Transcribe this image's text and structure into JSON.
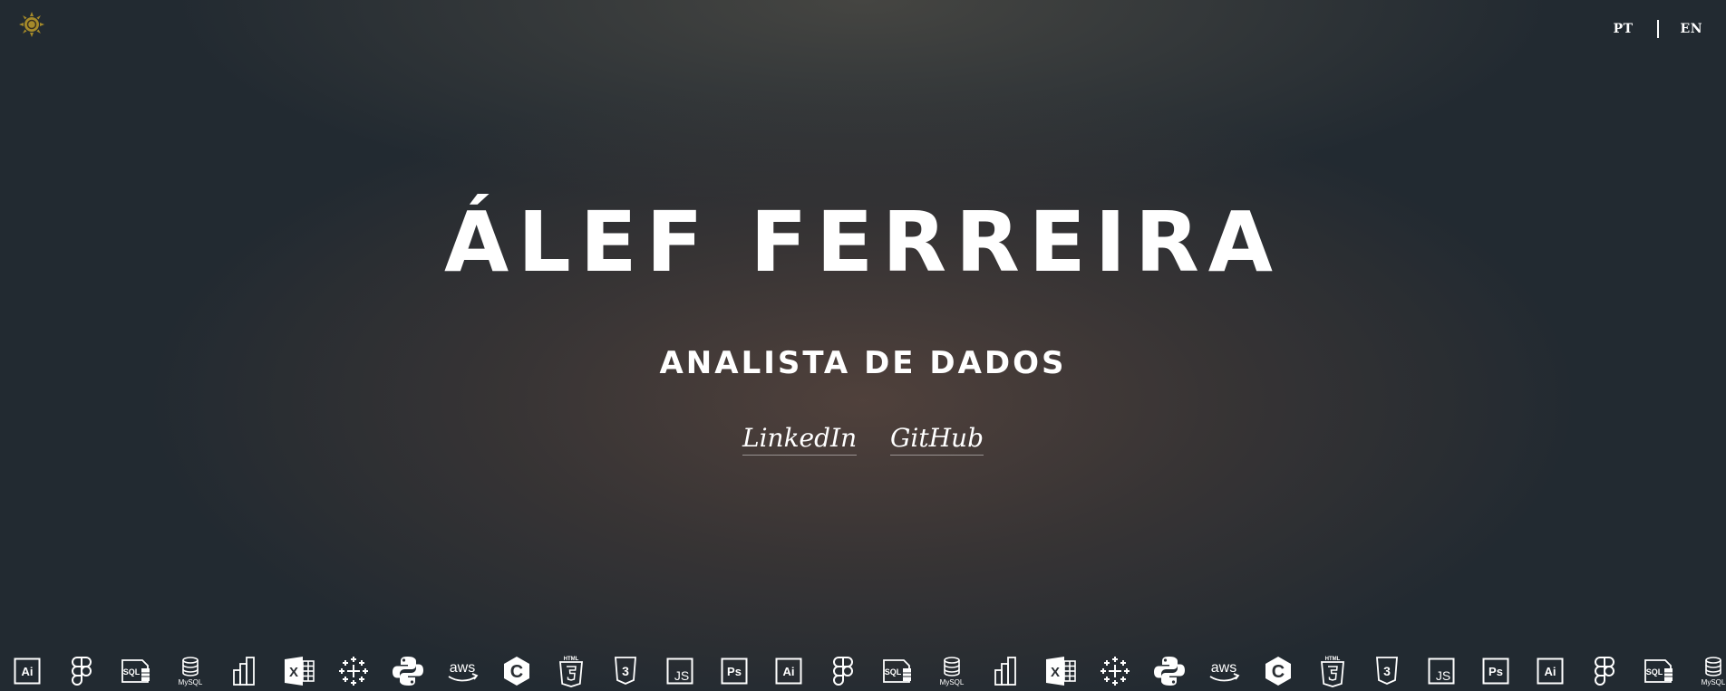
{
  "header": {
    "theme_toggle_icon": "sun-icon",
    "theme_color": "#a58a2a",
    "languages": [
      {
        "label": "PT"
      },
      {
        "label": "EN"
      }
    ]
  },
  "hero": {
    "name": "ÁLEF FERREIRA",
    "role": "ANALISTA DE DADOS",
    "links": [
      {
        "label": "LinkedIn"
      },
      {
        "label": "GitHub"
      }
    ]
  },
  "tech_strip": {
    "icons": [
      {
        "name": "illustrator-icon",
        "text": "Ai"
      },
      {
        "name": "figma-icon"
      },
      {
        "name": "sql-server-icon",
        "text": "SQL"
      },
      {
        "name": "mysql-icon",
        "text": "MySQL"
      },
      {
        "name": "power-bi-icon"
      },
      {
        "name": "excel-icon",
        "text": "X"
      },
      {
        "name": "tableau-icon"
      },
      {
        "name": "python-icon"
      },
      {
        "name": "aws-icon",
        "text": "aws"
      },
      {
        "name": "c-icon",
        "text": "C"
      },
      {
        "name": "html5-icon",
        "text": "HTML"
      },
      {
        "name": "css3-icon",
        "text": "3"
      },
      {
        "name": "javascript-icon",
        "text": "JS"
      },
      {
        "name": "photoshop-icon",
        "text": "Ps"
      },
      {
        "name": "illustrator-icon",
        "text": "Ai"
      },
      {
        "name": "figma-icon"
      },
      {
        "name": "sql-server-icon",
        "text": "SQL"
      },
      {
        "name": "mysql-icon",
        "text": "MySQL"
      },
      {
        "name": "power-bi-icon"
      },
      {
        "name": "excel-icon",
        "text": "X"
      },
      {
        "name": "tableau-icon"
      },
      {
        "name": "python-icon"
      },
      {
        "name": "aws-icon",
        "text": "aws"
      },
      {
        "name": "c-icon",
        "text": "C"
      },
      {
        "name": "html5-icon",
        "text": "HTML"
      },
      {
        "name": "css3-icon",
        "text": "3"
      },
      {
        "name": "javascript-icon",
        "text": "JS"
      },
      {
        "name": "photoshop-icon",
        "text": "Ps"
      },
      {
        "name": "illustrator-icon",
        "text": "Ai"
      },
      {
        "name": "figma-icon"
      },
      {
        "name": "sql-server-icon",
        "text": "SQL"
      },
      {
        "name": "mysql-icon",
        "text": "MySQL"
      }
    ]
  }
}
